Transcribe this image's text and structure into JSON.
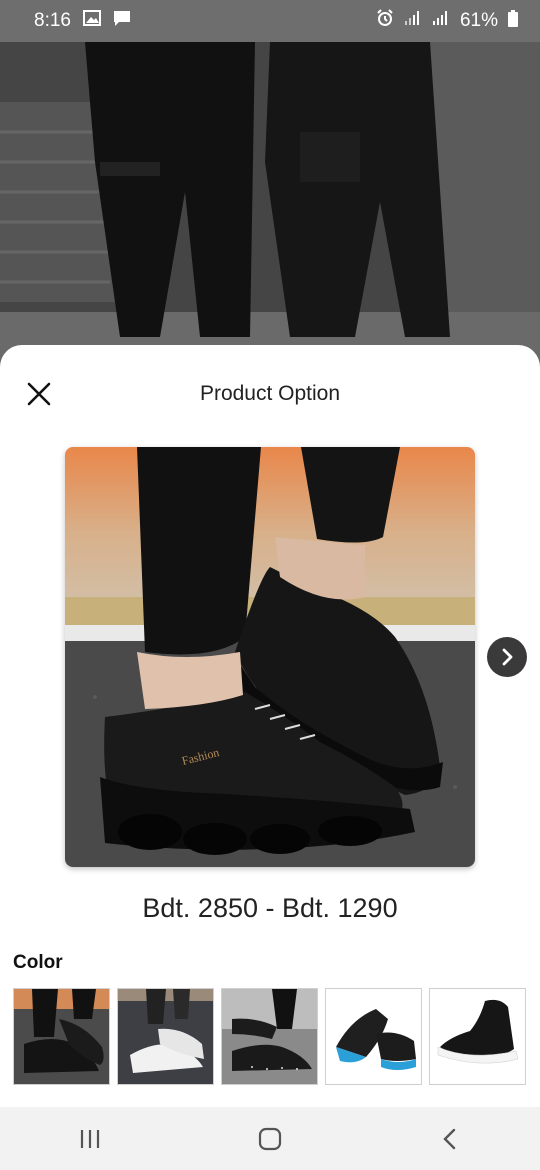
{
  "status_bar": {
    "time": "8:16",
    "left_icons": [
      "image-icon",
      "message-icon"
    ],
    "battery": "61%",
    "right_icons": [
      "alarm-icon",
      "signal-icon",
      "signal-icon",
      "battery-icon"
    ]
  },
  "sheet": {
    "title": "Product Option",
    "close_icon": "close-icon",
    "next_icon": "chevron-right-icon"
  },
  "product": {
    "price_range": "Bdt. 2850 - Bdt. 1290",
    "shoe_brand_text": "Fashion"
  },
  "color_section": {
    "label": "Color",
    "swatches": [
      {
        "name": "black-shoe-on-feet"
      },
      {
        "name": "white-shoe"
      },
      {
        "name": "black-speckled-shoe"
      },
      {
        "name": "black-blue-shoe"
      },
      {
        "name": "black-high-top-shoe"
      }
    ]
  },
  "nav_bar": {
    "icons": [
      "recent-apps-icon",
      "home-icon",
      "back-icon"
    ]
  },
  "colors": {
    "sheet_bg": "#ffffff",
    "status_bar": "#6e6e6e",
    "nav_bar": "#f2f2f2",
    "next_button": "#3a3a3a"
  }
}
